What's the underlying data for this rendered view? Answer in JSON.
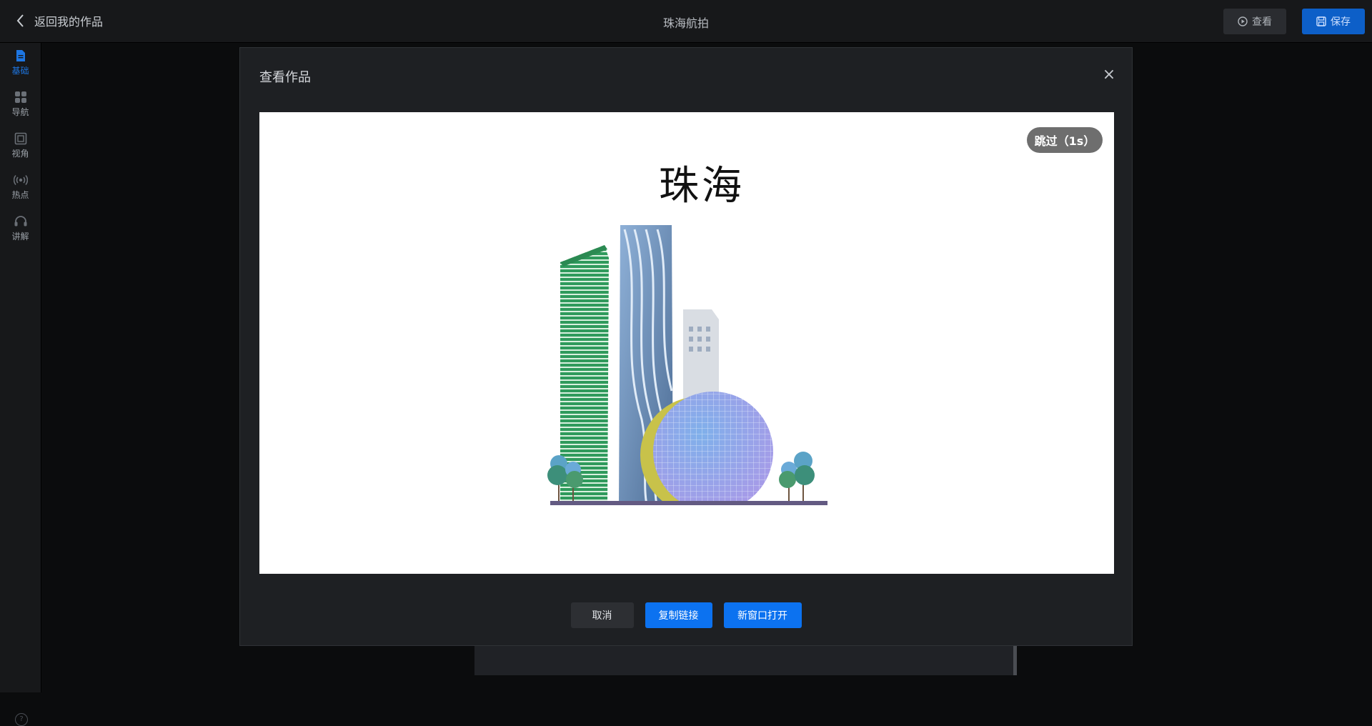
{
  "topbar": {
    "back_label": "返回我的作品",
    "project_title": "珠海航拍",
    "view_label": "查看",
    "save_label": "保存"
  },
  "sidebar": {
    "items": [
      {
        "label": "基础",
        "icon": "document-icon",
        "active": true
      },
      {
        "label": "导航",
        "icon": "grid-icon",
        "active": false
      },
      {
        "label": "视角",
        "icon": "image-frame-icon",
        "active": false
      },
      {
        "label": "热点",
        "icon": "broadcast-icon",
        "active": false
      },
      {
        "label": "讲解",
        "icon": "headset-icon",
        "active": false
      }
    ],
    "help_icon": "?"
  },
  "modal": {
    "title": "查看作品",
    "preview": {
      "skip_label": "跳过（1s）",
      "city_name": "珠海"
    },
    "buttons": {
      "cancel": "取消",
      "copy_link": "复制链接",
      "open_new_window": "新窗口打开"
    }
  },
  "colors": {
    "accent": "#0c72f0",
    "save": "#0d5fc8",
    "active_sidebar": "#1d76e3"
  }
}
